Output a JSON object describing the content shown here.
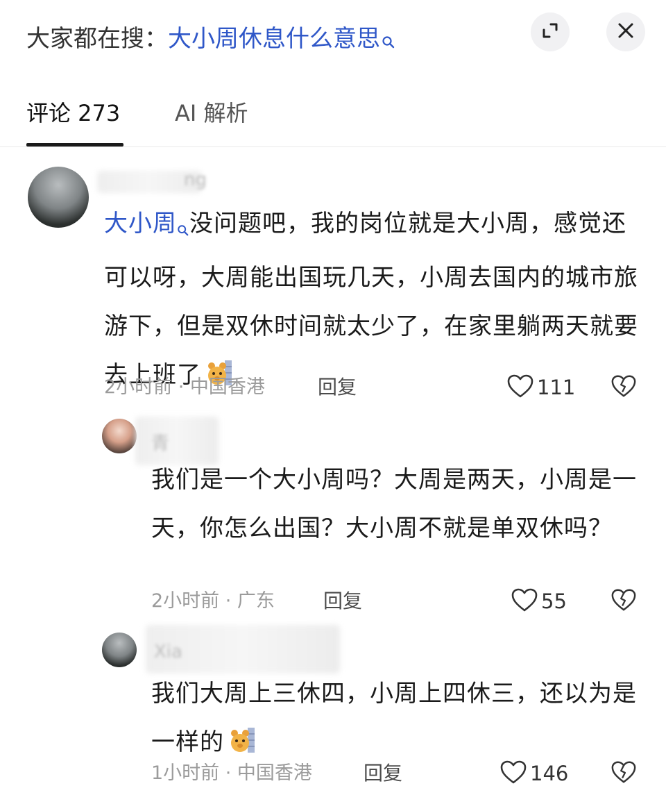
{
  "header": {
    "search_prefix": "大家都在搜：",
    "search_term": "大小周休息什么意思"
  },
  "tabs": [
    {
      "label": "评论 273",
      "active": true
    },
    {
      "label": "AI 解析",
      "active": false
    }
  ],
  "comments": [
    {
      "username": "ng",
      "keyword": "大小周",
      "text": "没问题吧，我的岗位就是大小周，感觉还可以呀，大周能出国玩几天，小周去国内的城市旅游下，但是双休时间就太少了，在家里躺两天就要去上班了",
      "meta": "2小时前 · 中国香港",
      "reply_label": "回复",
      "likes": "111"
    },
    {
      "username": "青",
      "text": "我们是一个大小周吗？大周是两天，小周是一天，你怎么出国？大小周不就是单双休吗？",
      "meta": "2小时前 · 广东",
      "reply_label": "回复",
      "likes": "55"
    },
    {
      "username": "Xia",
      "text": "我们大周上三休四，小周上四休三，还以为是一样的",
      "meta": "1小时前 · 中国香港",
      "reply_label": "回复",
      "likes": "146"
    }
  ],
  "colors": {
    "link": "#2f57c8",
    "meta_gray": "#9b9b9b"
  }
}
